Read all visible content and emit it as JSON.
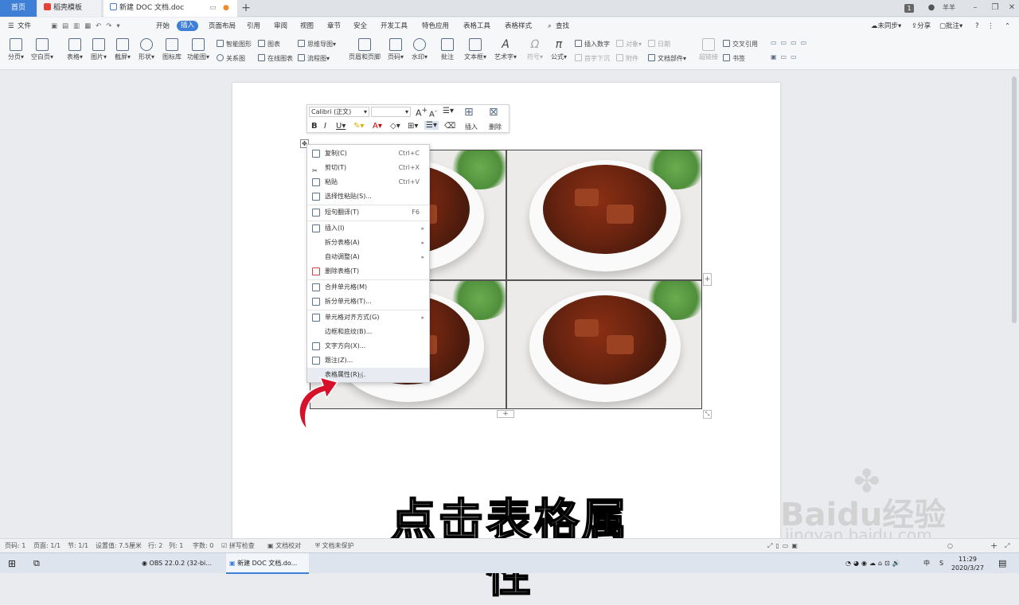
{
  "tabs": {
    "home": "首页",
    "template": "稻壳模板",
    "doc": "新建 DOC 文档.doc"
  },
  "window": {
    "user": "羊羊",
    "user_badge": "1"
  },
  "menu": {
    "file": "文件",
    "items": [
      "开始",
      "插入",
      "页面布局",
      "引用",
      "审阅",
      "视图",
      "章节",
      "安全",
      "开发工具",
      "特色应用",
      "表格工具",
      "表格样式"
    ],
    "search": "查找",
    "right": [
      "未同步",
      "分享",
      "批注"
    ]
  },
  "ribbon": {
    "big": [
      "分页",
      "空白页",
      "表格",
      "图片",
      "截屏",
      "形状",
      "图标库",
      "功能图",
      "页眉和页脚",
      "页码",
      "水印",
      "批注",
      "文本框",
      "艺术字",
      "符号",
      "公式",
      "超链接",
      "书签"
    ],
    "small": {
      "smart_shape": "智能图形",
      "chart": "图表",
      "mind_map": "思维导图",
      "relation": "关系图",
      "online_chart": "在线图表",
      "flowchart": "流程图",
      "insert_number": "插入数字",
      "object": "对象",
      "date": "日期",
      "first_letter": "首字下沉",
      "attachment": "附件",
      "doc_parts": "文档部件",
      "cross_ref": "交叉引用"
    }
  },
  "floatbar": {
    "font": "Calibri (正文)",
    "insert": "插入",
    "delete": "删除"
  },
  "context_menu": [
    {
      "label": "复制(C)",
      "shortcut": "Ctrl+C"
    },
    {
      "label": "剪切(T)",
      "shortcut": "Ctrl+X"
    },
    {
      "label": "粘贴",
      "shortcut": "Ctrl+V"
    },
    {
      "label": "选择性粘贴(S)...",
      "shortcut": ""
    },
    {
      "label": "短句翻译(T)",
      "shortcut": "F6"
    },
    {
      "label": "插入(I)",
      "shortcut": ""
    },
    {
      "label": "拆分表格(A)",
      "shortcut": ""
    },
    {
      "label": "自动调整(A)",
      "shortcut": ""
    },
    {
      "label": "删除表格(T)",
      "shortcut": ""
    },
    {
      "label": "合并单元格(M)",
      "shortcut": ""
    },
    {
      "label": "拆分单元格(T)...",
      "shortcut": ""
    },
    {
      "label": "单元格对齐方式(G)",
      "shortcut": ""
    },
    {
      "label": "边框和底纹(B)...",
      "shortcut": ""
    },
    {
      "label": "文字方向(X)...",
      "shortcut": ""
    },
    {
      "label": "题注(Z)...",
      "shortcut": ""
    },
    {
      "label": "表格属性(R)...",
      "shortcut": ""
    }
  ],
  "subtitle": "点击表格属性",
  "watermark": {
    "brand": "Baidu经验",
    "url": "jingyan.baidu.com"
  },
  "status": {
    "page": "页码: 1",
    "pages": "页面: 1/1",
    "section": "节: 1/1",
    "setting": "设置值: 7.5厘米",
    "row": "行: 2",
    "col": "列: 1",
    "words": "字数: 0",
    "spell": "拼写检查",
    "proof": "文档校对",
    "protect": "文档未保护"
  },
  "taskbar": {
    "obs": "OBS 22.0.2 (32-bi...",
    "wps": "新建 DOC 文档.do...",
    "ime": "中",
    "ime2": "S",
    "time": "11:29",
    "date": "2020/3/27"
  },
  "colors": {
    "accent": "#3f7fd6",
    "arrow": "#d8112b"
  }
}
